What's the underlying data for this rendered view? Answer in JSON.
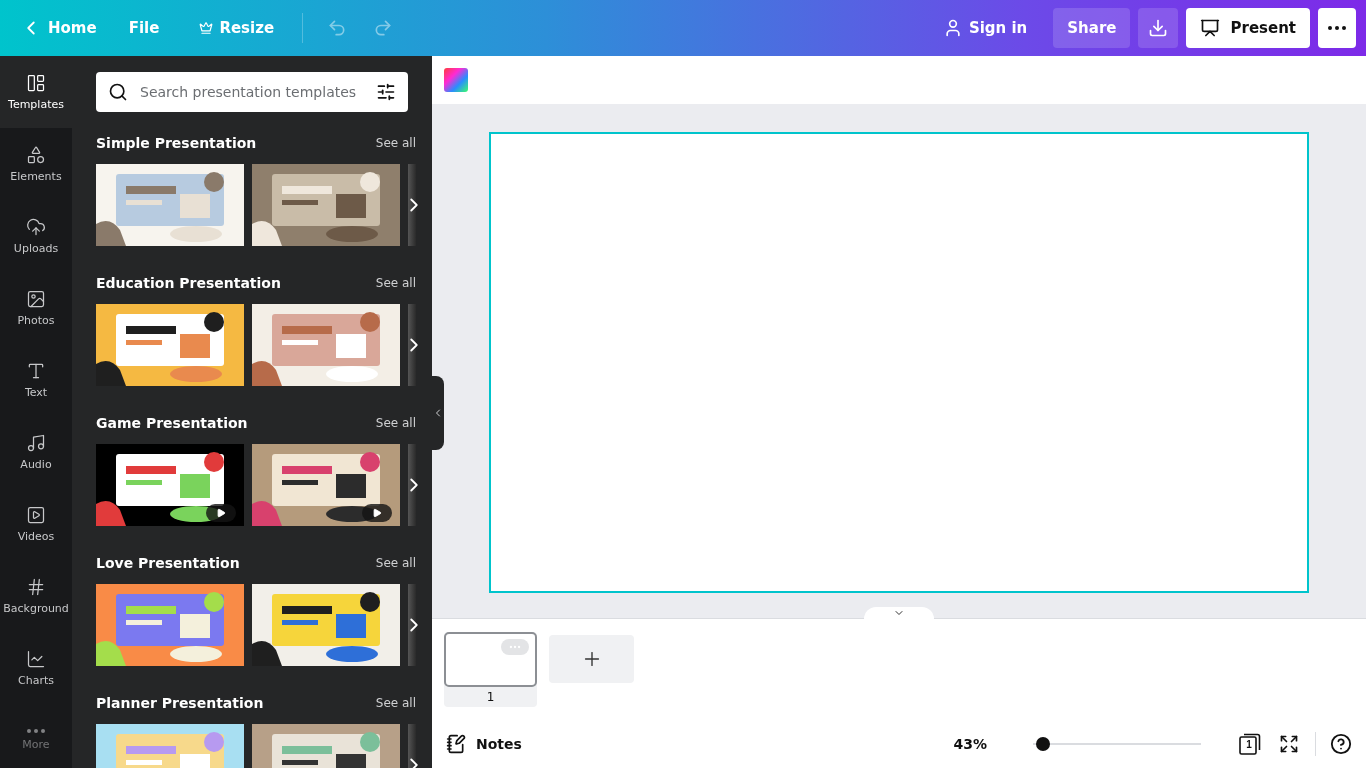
{
  "topbar": {
    "back": "Home",
    "menu": [
      "File",
      "Resize"
    ],
    "sign_in": "Sign in",
    "share": "Share",
    "present": "Present"
  },
  "rail": [
    {
      "label": "Templates",
      "selected": true
    },
    {
      "label": "Elements",
      "selected": false
    },
    {
      "label": "Uploads",
      "selected": false
    },
    {
      "label": "Photos",
      "selected": false
    },
    {
      "label": "Text",
      "selected": false
    },
    {
      "label": "Audio",
      "selected": false
    },
    {
      "label": "Videos",
      "selected": false
    },
    {
      "label": "Background",
      "selected": false
    },
    {
      "label": "Charts",
      "selected": false
    },
    {
      "label": "More",
      "selected": false
    }
  ],
  "search": {
    "placeholder": "Search presentation templates"
  },
  "sections": [
    {
      "title": "Simple Presentation",
      "see_all": "See all"
    },
    {
      "title": "Education Presentation",
      "see_all": "See all"
    },
    {
      "title": "Game Presentation",
      "see_all": "See all",
      "templates": [
        {
          "kind": "video"
        },
        {
          "kind": "video"
        }
      ]
    },
    {
      "title": "Love Presentation",
      "see_all": "See all"
    },
    {
      "title": "Planner Presentation",
      "see_all": "See all"
    }
  ],
  "pages": [
    {
      "number": "1",
      "selected": true
    }
  ],
  "footer": {
    "notes": "Notes",
    "zoom": "43%",
    "zoom_slider": {
      "level": 0.06
    },
    "page_count": "1"
  }
}
